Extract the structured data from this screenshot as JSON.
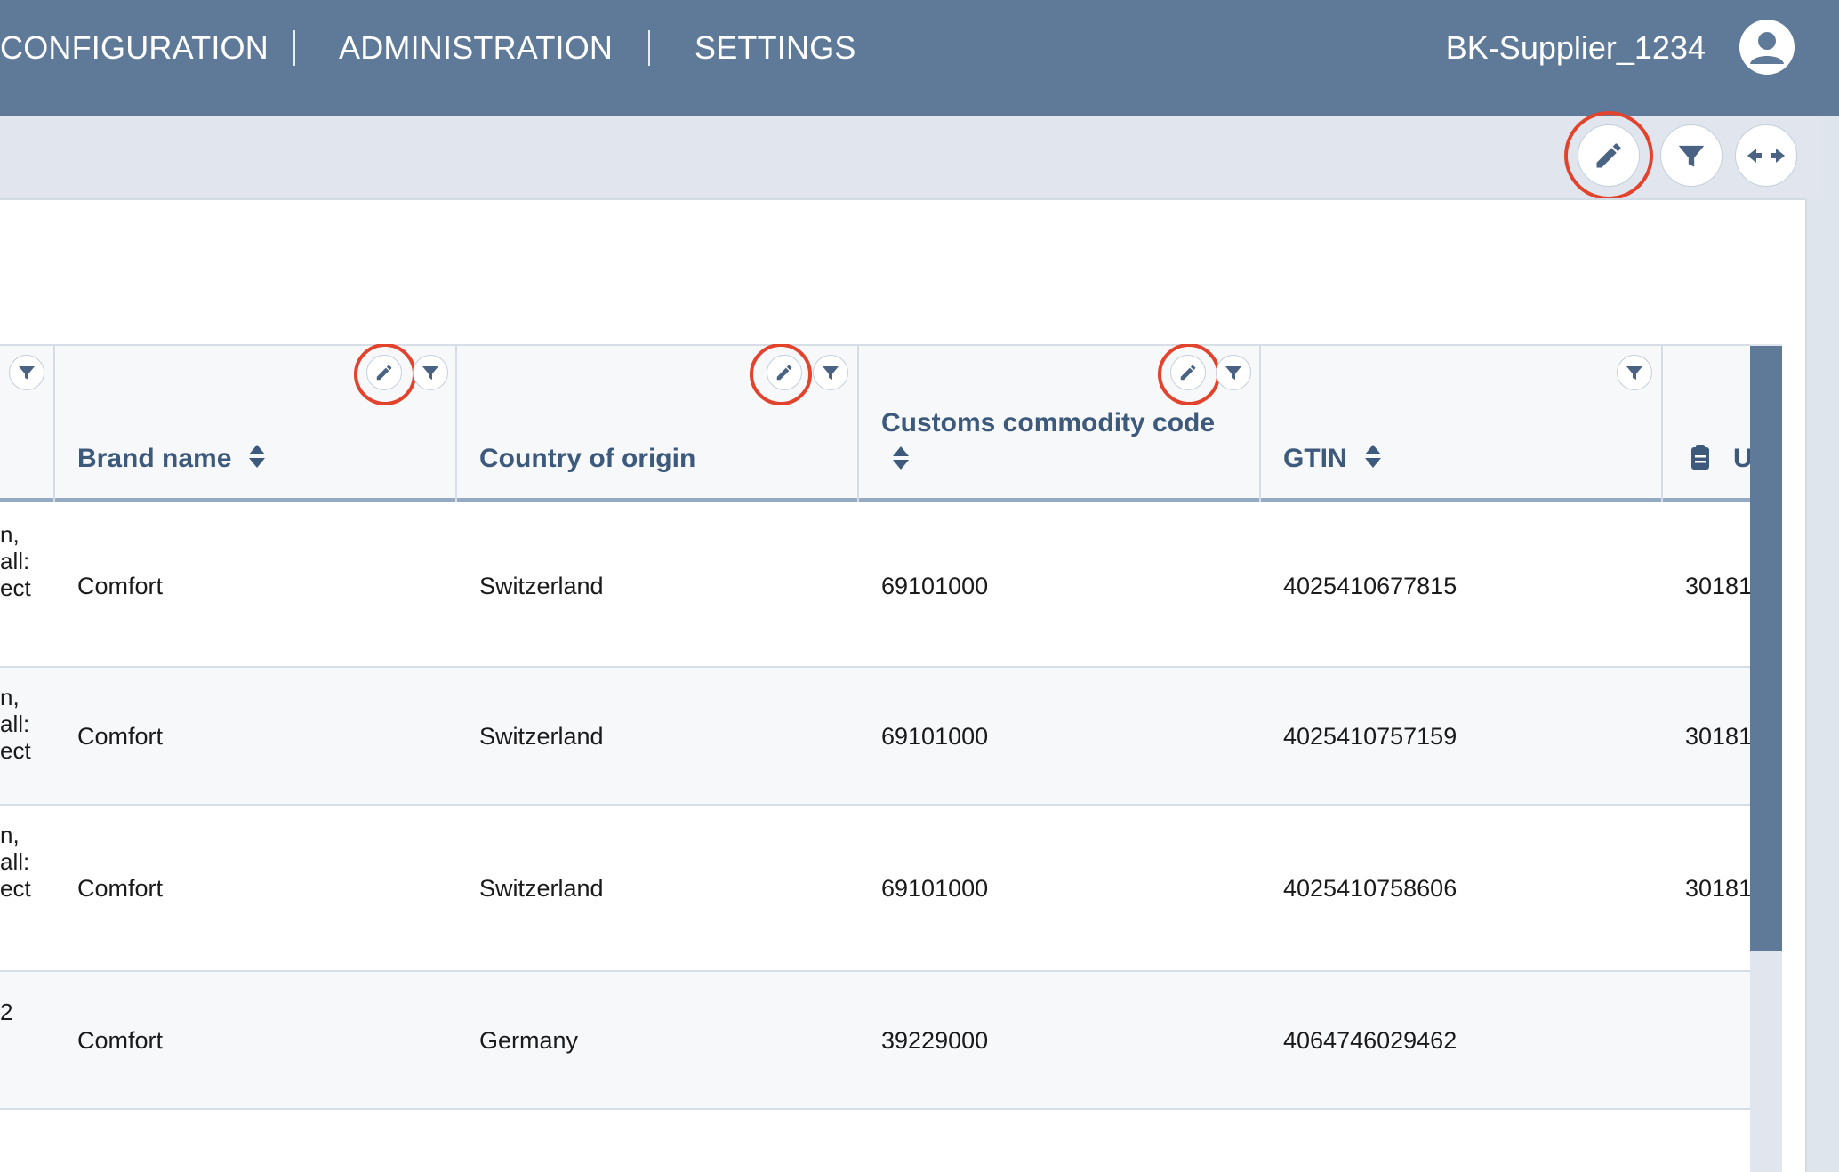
{
  "nav": {
    "items": [
      "CONFIGURATION",
      "ADMINISTRATION",
      "SETTINGS"
    ],
    "username": "BK-Supplier_1234"
  },
  "toolbar": {
    "edit_icon": "pencil-icon",
    "filter_icon": "filter-icon",
    "expand_icon": "arrows-horizontal-icon"
  },
  "table": {
    "columns": {
      "brand": "Brand name",
      "country": "Country of origin",
      "customs": "Customs commodity code",
      "gtin": "GTIN",
      "partial": "U"
    },
    "rows": [
      {
        "frag": "n,\nall:\nect",
        "brand": "Comfort",
        "country": "Switzerland",
        "customs": "69101000",
        "gtin": "4025410677815",
        "partial": "30181"
      },
      {
        "frag": "n,\nall:\nect",
        "brand": "Comfort",
        "country": "Switzerland",
        "customs": "69101000",
        "gtin": "4025410757159",
        "partial": "30181"
      },
      {
        "frag": "n,\nall:\nect",
        "brand": "Comfort",
        "country": "Switzerland",
        "customs": "69101000",
        "gtin": "4025410758606",
        "partial": "30181"
      },
      {
        "frag": "2",
        "brand": "Comfort",
        "country": "Germany",
        "customs": "39229000",
        "gtin": "4064746029462",
        "partial": ""
      }
    ]
  },
  "colors": {
    "nav_bg": "#5f7a98",
    "header_text": "#3d5a7d",
    "highlight_ring": "#e2432d"
  }
}
